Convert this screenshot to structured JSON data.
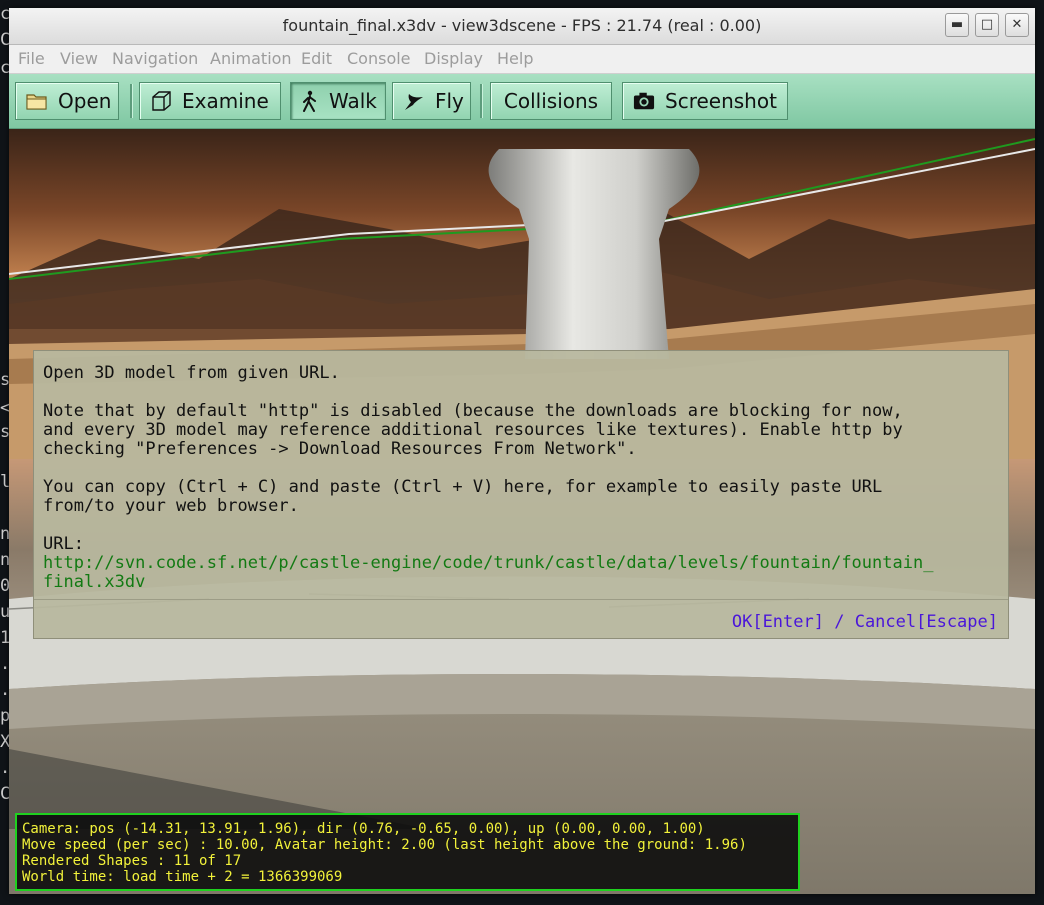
{
  "window": {
    "title": "fountain_final.x3dv - view3dscene - FPS : 21.74 (real : 0.00)",
    "controls": {
      "minimize": "▬",
      "maximize": "□",
      "close": "✕"
    }
  },
  "menu": {
    "items": [
      "File",
      "View",
      "Navigation",
      "Animation",
      "Edit",
      "Console",
      "Display",
      "Help"
    ]
  },
  "toolbar": {
    "open": {
      "label": "Open",
      "icon": "folder-icon"
    },
    "examine": {
      "label": "Examine",
      "icon": "cube-icon"
    },
    "walk": {
      "label": "Walk",
      "icon": "walking-person-icon"
    },
    "fly": {
      "label": "Fly",
      "icon": "bird-icon"
    },
    "collisions": {
      "label": "Collisions"
    },
    "screenshot": {
      "label": "Screenshot",
      "icon": "camera-icon"
    },
    "accent": "#8fd3ae"
  },
  "dialog": {
    "line1": "Open 3D model from given URL.",
    "note1": "Note that by default \"http\" is disabled (because the downloads are blocking for now,",
    "note2": "and every 3D model may reference additional resources like textures). Enable http by",
    "note3": "checking \"Preferences -> Download Resources From Network\".",
    "copy1": "You can copy (Ctrl + C) and paste (Ctrl + V) here, for example to easily paste URL",
    "copy2": "from/to your web browser.",
    "url_label": "URL:",
    "url_value_1": "http://svn.code.sf.net/p/castle-engine/code/trunk/castle/data/levels/fountain/fountain_",
    "url_value_2": "final.x3dv",
    "ok": "OK[Enter]",
    "sep": " / ",
    "cancel": "Cancel[Escape]",
    "url_color": "#137a13",
    "action_color": "#4a16d9"
  },
  "status": {
    "camera": "Camera: pos (-14.31, 13.91, 1.96), dir (0.76, -0.65, 0.00), up (0.00, 0.00, 1.00)",
    "speed": "Move speed (per sec) : 10.00, Avatar height: 2.00 (last height above the ground: 1.96)",
    "shapes": "Rendered Shapes : 11 of 17",
    "time": "World time: load time + 2 = 1366399069",
    "text_color": "#f2f23a",
    "border_color": "#1fd11f"
  }
}
